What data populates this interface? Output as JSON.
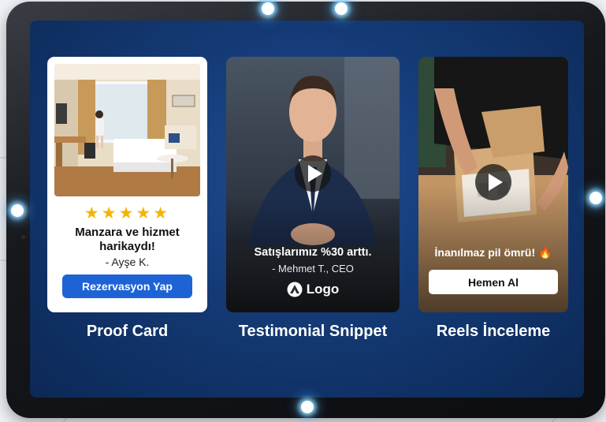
{
  "proof_card": {
    "rating_stars": "★★★★★",
    "review": "Manzara ve hizmet harikaydı!",
    "author": "- Ayşe K.",
    "button_label": "Rezervasyon Yap",
    "caption": "Proof Card"
  },
  "testimonial": {
    "quote": "Satışlarımız %30 arttı.",
    "author": "- Mehmet T., CEO",
    "logo_text": "Logo",
    "caption": "Testimonial Snippet"
  },
  "reels": {
    "overlay_text": "İnanılmaz pil ömrü! 🔥",
    "button_label": "Hemen Al",
    "caption": "Reels İnceleme"
  },
  "colors": {
    "screen_blue": "#143a75",
    "button_blue": "#1e63d6",
    "star_gold": "#f5b400"
  }
}
